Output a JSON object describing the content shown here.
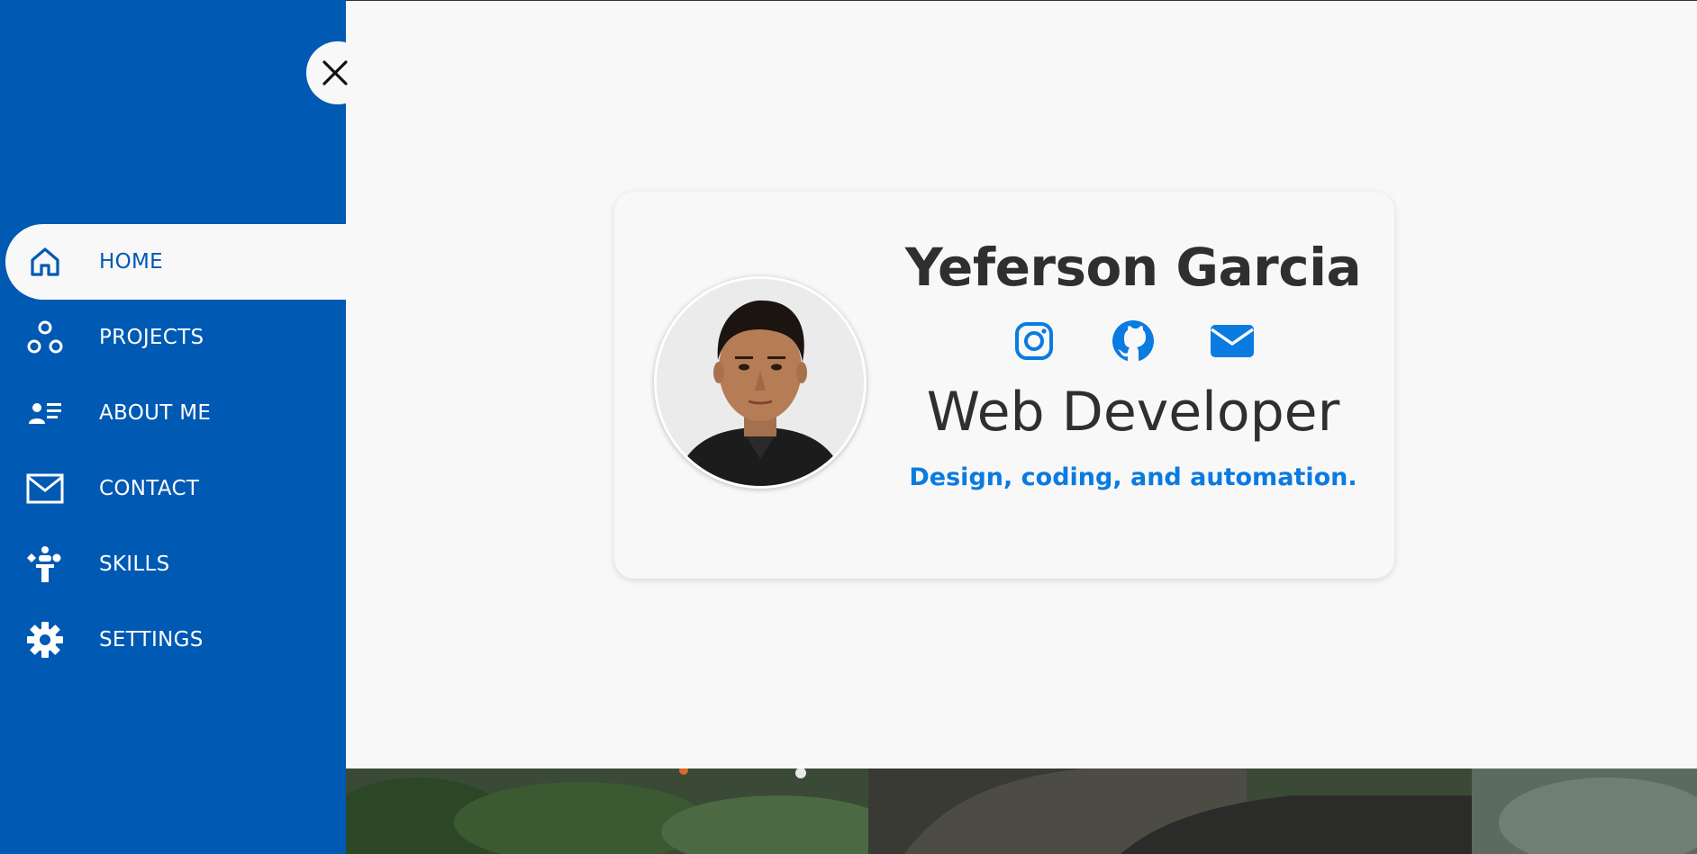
{
  "sidebar": {
    "close_icon": "close-icon",
    "items": [
      {
        "label": "HOME",
        "icon": "home-icon",
        "active": true
      },
      {
        "label": "PROJECTS",
        "icon": "projects-icon",
        "active": false
      },
      {
        "label": "ABOUT ME",
        "icon": "about-me-icon",
        "active": false
      },
      {
        "label": "CONTACT",
        "icon": "contact-icon",
        "active": false
      },
      {
        "label": "SKILLS",
        "icon": "skills-icon",
        "active": false
      },
      {
        "label": "SETTINGS",
        "icon": "settings-icon",
        "active": false
      }
    ]
  },
  "profile": {
    "name": "Yeferson Garcia",
    "role": "Web Developer",
    "tagline": "Design, coding, and automation.",
    "social": [
      "instagram-icon",
      "github-icon",
      "email-icon"
    ]
  },
  "colors": {
    "sidebar": "#0059b3",
    "accent": "#0a7be0",
    "background": "#f8f8f8",
    "text": "#2f2f2f"
  }
}
